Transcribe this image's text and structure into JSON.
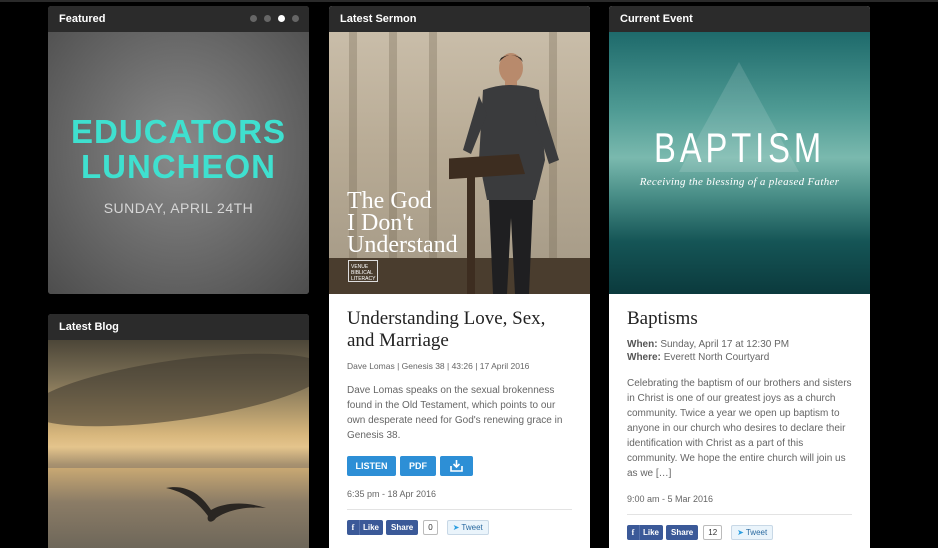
{
  "featured": {
    "header": "Featured",
    "slides_count": 4,
    "active_slide": 3,
    "image_title_line1": "EDUCATORS",
    "image_title_line2": "LUNCHEON",
    "image_date": "SUNDAY, APRIL 24TH"
  },
  "blog": {
    "header": "Latest Blog"
  },
  "sermon": {
    "header": "Latest Sermon",
    "image_title_line1": "The God",
    "image_title_line2": "I Don't",
    "image_title_line3": "Understand",
    "image_logo_text": "VENUE BIBLICAL LITERACY",
    "title": "Understanding Love, Sex, and Marriage",
    "meta": "Dave Lomas | Genesis 38 | 43:26 | 17 April 2016",
    "description": "Dave Lomas speaks on the sexual brokenness found in the Old Testament, which points to our own desperate need for God's renewing grace in Genesis 38.",
    "buttons": {
      "listen": "LISTEN",
      "pdf": "PDF",
      "download_icon": "download-icon"
    },
    "time": "6:35 pm - 18 Apr 2016",
    "social": {
      "like": "Like",
      "share": "Share",
      "count": "0",
      "tweet": "Tweet"
    }
  },
  "event": {
    "header": "Current Event",
    "image_title": "BAPTISM",
    "image_subtitle": "Receiving the blessing of a pleased Father",
    "title": "Baptisms",
    "when_label": "When:",
    "when_value": "Sunday, April 17 at 12:30 PM",
    "where_label": "Where:",
    "where_value": "Everett North Courtyard",
    "description": "Celebrating the baptism of our brothers and sisters in Christ is one of our greatest joys as a church community. Twice a year we open up baptism to anyone in our church who desires to declare their identification with Christ as a part of this community. We hope the entire church will join us as we […]",
    "time": "9:00 am - 5 Mar 2016",
    "social": {
      "like": "Like",
      "share": "Share",
      "count": "12",
      "tweet": "Tweet"
    }
  },
  "colors": {
    "accent": "#2d8fd6",
    "facebook": "#3b5998",
    "header_bg": "#2b2b2b",
    "featured_title": "#3fe0cf"
  }
}
